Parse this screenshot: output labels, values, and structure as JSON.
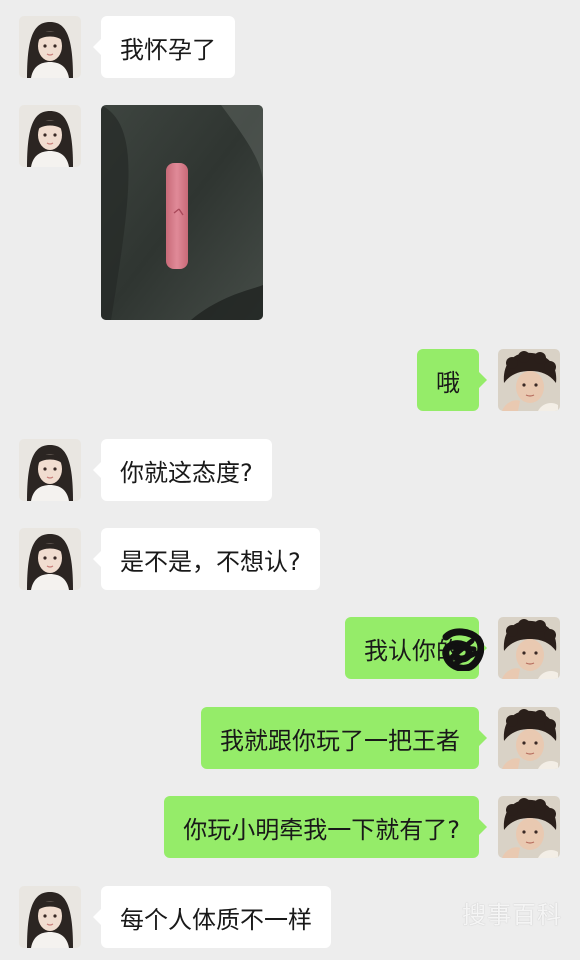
{
  "messages": [
    {
      "side": "left",
      "sender": "girl",
      "type": "text",
      "text": "我怀孕了"
    },
    {
      "side": "left",
      "sender": "girl",
      "type": "image",
      "image_description": "pregnancy-test-photo"
    },
    {
      "side": "right",
      "sender": "boy",
      "type": "text",
      "text": "哦"
    },
    {
      "side": "left",
      "sender": "girl",
      "type": "text",
      "text": "你就这态度?"
    },
    {
      "side": "left",
      "sender": "girl",
      "type": "text",
      "text": "是不是，不想认?"
    },
    {
      "side": "right",
      "sender": "boy",
      "type": "text",
      "text": "我认你的"
    },
    {
      "side": "right",
      "sender": "boy",
      "type": "text",
      "text": "我就跟你玩了一把王者"
    },
    {
      "side": "right",
      "sender": "boy",
      "type": "text",
      "text": "你玩小明牵我一下就有了?"
    },
    {
      "side": "left",
      "sender": "girl",
      "type": "text",
      "text": "每个人体质不一样"
    }
  ],
  "watermark": "搜事百科",
  "colors": {
    "background": "#ededed",
    "incoming_bubble": "#ffffff",
    "outgoing_bubble": "#95ec69",
    "text": "#191919"
  }
}
